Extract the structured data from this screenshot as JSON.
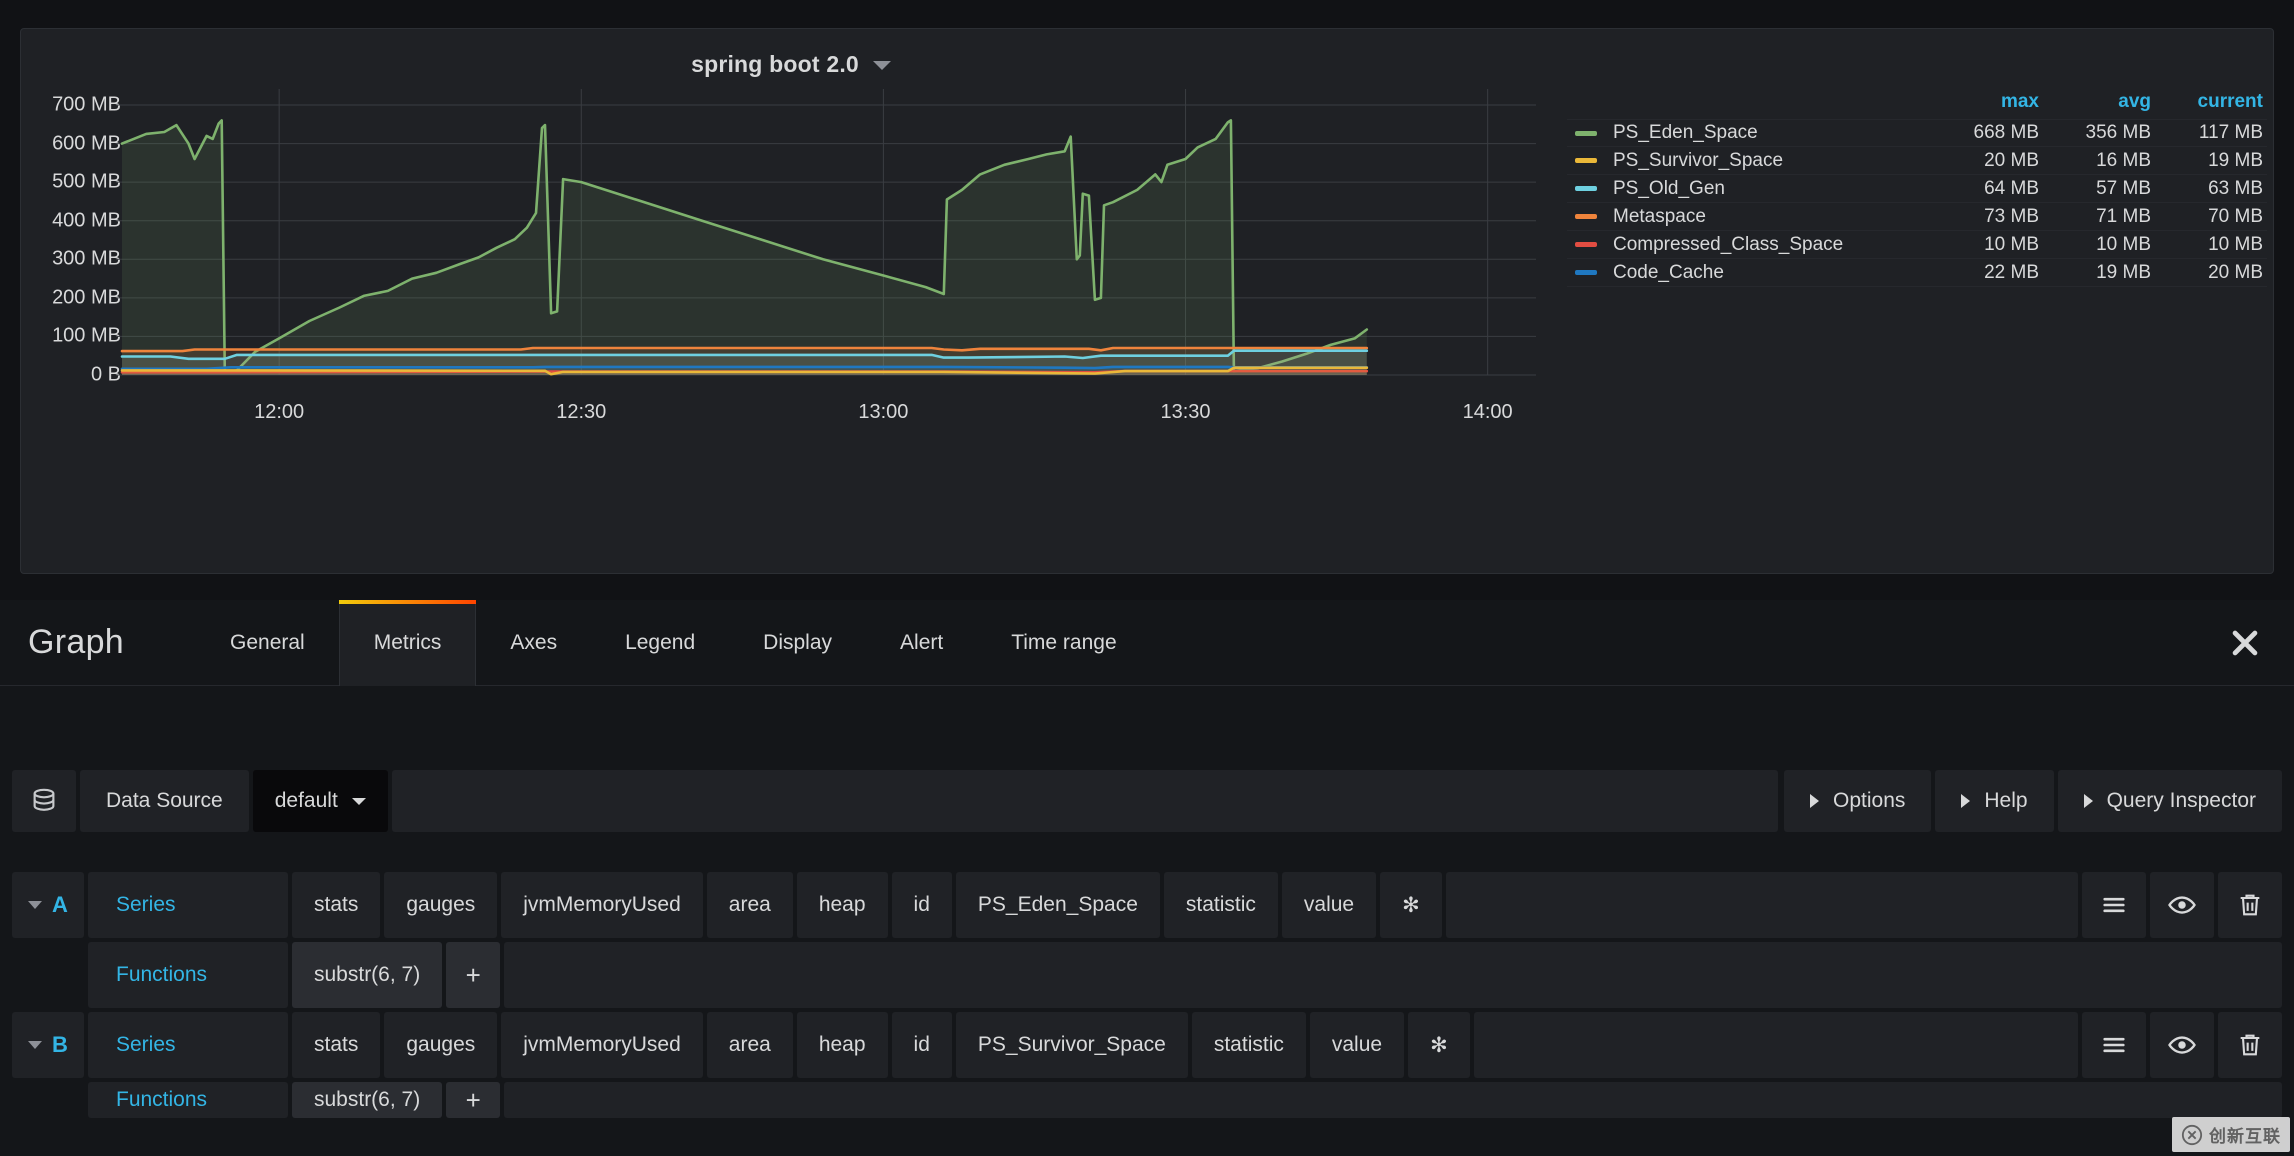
{
  "panel": {
    "title": "spring boot 2.0",
    "title_caret_icon": "chevron-down-icon"
  },
  "chart_data": {
    "type": "area",
    "title": "spring boot 2.0",
    "xlabel": "",
    "ylabel": "",
    "ylim": [
      0,
      700
    ],
    "yunit": "MB",
    "grid": true,
    "legend_position": "right",
    "y_ticks": [
      "0 B",
      "100 MB",
      "200 MB",
      "300 MB",
      "400 MB",
      "500 MB",
      "600 MB",
      "700 MB"
    ],
    "y_tick_values": [
      0,
      100,
      200,
      300,
      400,
      500,
      600,
      700
    ],
    "x_ticks": [
      "12:00",
      "12:30",
      "13:00",
      "13:30",
      "14:00"
    ],
    "x_tick_values": [
      12.0,
      12.5,
      13.0,
      13.5,
      14.0
    ],
    "xlim": [
      11.73,
      14.08
    ],
    "series": [
      {
        "name": "PS_Eden_Space",
        "color": "#7eb26d",
        "max": "668 MB",
        "avg": "356 MB",
        "current": "117 MB",
        "points": [
          [
            11.74,
            600
          ],
          [
            11.78,
            625
          ],
          [
            11.81,
            630
          ],
          [
            11.83,
            648
          ],
          [
            11.85,
            600
          ],
          [
            11.86,
            560
          ],
          [
            11.88,
            620
          ],
          [
            11.89,
            612
          ],
          [
            11.9,
            652
          ],
          [
            11.905,
            660
          ],
          [
            11.91,
            8
          ],
          [
            11.93,
            12
          ],
          [
            11.96,
            60
          ],
          [
            12.0,
            95
          ],
          [
            12.05,
            140
          ],
          [
            12.1,
            175
          ],
          [
            12.14,
            205
          ],
          [
            12.18,
            218
          ],
          [
            12.22,
            250
          ],
          [
            12.26,
            265
          ],
          [
            12.3,
            288
          ],
          [
            12.33,
            305
          ],
          [
            12.36,
            330
          ],
          [
            12.39,
            352
          ],
          [
            12.41,
            382
          ],
          [
            12.425,
            420
          ],
          [
            12.435,
            640
          ],
          [
            12.44,
            648
          ],
          [
            12.45,
            160
          ],
          [
            12.46,
            165
          ],
          [
            12.47,
            508
          ],
          [
            12.5,
            500
          ],
          [
            12.6,
            450
          ],
          [
            12.7,
            400
          ],
          [
            12.8,
            350
          ],
          [
            12.9,
            300
          ],
          [
            13.0,
            258
          ],
          [
            13.07,
            228
          ],
          [
            13.1,
            210
          ],
          [
            13.105,
            455
          ],
          [
            13.13,
            480
          ],
          [
            13.16,
            520
          ],
          [
            13.2,
            545
          ],
          [
            13.24,
            560
          ],
          [
            13.27,
            572
          ],
          [
            13.3,
            580
          ],
          [
            13.31,
            618
          ],
          [
            13.32,
            300
          ],
          [
            13.325,
            310
          ],
          [
            13.33,
            470
          ],
          [
            13.34,
            465
          ],
          [
            13.35,
            195
          ],
          [
            13.36,
            200
          ],
          [
            13.365,
            440
          ],
          [
            13.38,
            448
          ],
          [
            13.42,
            480
          ],
          [
            13.45,
            520
          ],
          [
            13.46,
            500
          ],
          [
            13.47,
            545
          ],
          [
            13.5,
            560
          ],
          [
            13.52,
            590
          ],
          [
            13.55,
            612
          ],
          [
            13.57,
            655
          ],
          [
            13.575,
            660
          ],
          [
            13.58,
            10
          ],
          [
            13.62,
            18
          ],
          [
            13.66,
            35
          ],
          [
            13.7,
            55
          ],
          [
            13.74,
            78
          ],
          [
            13.78,
            95
          ],
          [
            13.8,
            118
          ]
        ]
      },
      {
        "name": "PS_Survivor_Space",
        "color": "#eab839",
        "max": "20 MB",
        "avg": "16 MB",
        "current": "19 MB",
        "points": [
          [
            11.74,
            12
          ],
          [
            11.91,
            12
          ],
          [
            12.44,
            11
          ],
          [
            12.45,
            2
          ],
          [
            12.47,
            8
          ],
          [
            13.1,
            8
          ],
          [
            13.35,
            4
          ],
          [
            13.4,
            10
          ],
          [
            13.57,
            10
          ],
          [
            13.58,
            19
          ],
          [
            13.8,
            19
          ]
        ]
      },
      {
        "name": "PS_Old_Gen",
        "color": "#6ed0e0",
        "max": "64 MB",
        "avg": "57 MB",
        "current": "63 MB",
        "points": [
          [
            11.74,
            48
          ],
          [
            11.82,
            48
          ],
          [
            11.85,
            42
          ],
          [
            11.91,
            42
          ],
          [
            11.93,
            52
          ],
          [
            13.08,
            52
          ],
          [
            13.1,
            45
          ],
          [
            13.14,
            45
          ],
          [
            13.3,
            48
          ],
          [
            13.33,
            44
          ],
          [
            13.36,
            50
          ],
          [
            13.57,
            50
          ],
          [
            13.58,
            63
          ],
          [
            13.8,
            63
          ]
        ]
      },
      {
        "name": "Metaspace",
        "color": "#ef843c",
        "max": "73 MB",
        "avg": "71 MB",
        "current": "70 MB",
        "points": [
          [
            11.74,
            62
          ],
          [
            11.84,
            62
          ],
          [
            11.86,
            66
          ],
          [
            12.4,
            66
          ],
          [
            12.42,
            70
          ],
          [
            13.08,
            70
          ],
          [
            13.1,
            66
          ],
          [
            13.13,
            64
          ],
          [
            13.16,
            68
          ],
          [
            13.34,
            68
          ],
          [
            13.36,
            64
          ],
          [
            13.38,
            70
          ],
          [
            13.57,
            70
          ],
          [
            13.58,
            70
          ],
          [
            13.8,
            70
          ]
        ]
      },
      {
        "name": "Compressed_Class_Space",
        "color": "#e24d42",
        "max": "10 MB",
        "avg": "10 MB",
        "current": "10 MB",
        "points": [
          [
            11.74,
            7
          ],
          [
            11.91,
            7
          ],
          [
            12.45,
            9
          ],
          [
            13.1,
            9
          ],
          [
            13.35,
            7
          ],
          [
            13.4,
            10
          ],
          [
            13.8,
            10
          ]
        ]
      },
      {
        "name": "Code_Cache",
        "color": "#1f78c1",
        "max": "22 MB",
        "avg": "19 MB",
        "current": "20 MB",
        "points": [
          [
            11.74,
            16
          ],
          [
            11.88,
            16
          ],
          [
            11.92,
            20
          ],
          [
            12.42,
            20
          ],
          [
            12.44,
            21
          ],
          [
            13.1,
            21
          ],
          [
            13.3,
            19
          ],
          [
            13.35,
            18
          ],
          [
            13.38,
            21
          ],
          [
            13.57,
            21
          ],
          [
            13.58,
            20
          ],
          [
            13.8,
            20
          ]
        ]
      }
    ],
    "legend_columns": [
      "max",
      "avg",
      "current"
    ]
  },
  "editor": {
    "heading": "Graph",
    "close_icon": "close-icon",
    "tabs": [
      {
        "label": "General",
        "active": false
      },
      {
        "label": "Metrics",
        "active": true
      },
      {
        "label": "Axes",
        "active": false
      },
      {
        "label": "Legend",
        "active": false
      },
      {
        "label": "Display",
        "active": false
      },
      {
        "label": "Alert",
        "active": false
      },
      {
        "label": "Time range",
        "active": false
      }
    ]
  },
  "datasource_row": {
    "db_icon": "database-icon",
    "label": "Data Source",
    "value": "default",
    "buttons": [
      {
        "label": "Options",
        "icon": "triangle-right-icon"
      },
      {
        "label": "Help",
        "icon": "triangle-right-icon"
      },
      {
        "label": "Query Inspector",
        "icon": "triangle-right-icon"
      }
    ]
  },
  "queries": [
    {
      "refId": "A",
      "key": "Series",
      "segments": [
        "stats",
        "gauges",
        "jvmMemoryUsed",
        "area",
        "heap",
        "id",
        "PS_Eden_Space",
        "statistic",
        "value",
        "✻"
      ],
      "actions": [
        "menu-icon",
        "eye-icon",
        "trash-icon"
      ],
      "functions": {
        "key": "Functions",
        "items": [
          "substr(6, 7)"
        ],
        "add_label": "+"
      }
    },
    {
      "refId": "B",
      "key": "Series",
      "segments": [
        "stats",
        "gauges",
        "jvmMemoryUsed",
        "area",
        "heap",
        "id",
        "PS_Survivor_Space",
        "statistic",
        "value",
        "✻"
      ],
      "actions": [
        "menu-icon",
        "eye-icon",
        "trash-icon"
      ],
      "functions": {
        "key": "Functions",
        "items": [
          "substr(6, 7)"
        ],
        "add_label": "+"
      }
    }
  ],
  "watermark": {
    "text": "创新互联"
  }
}
